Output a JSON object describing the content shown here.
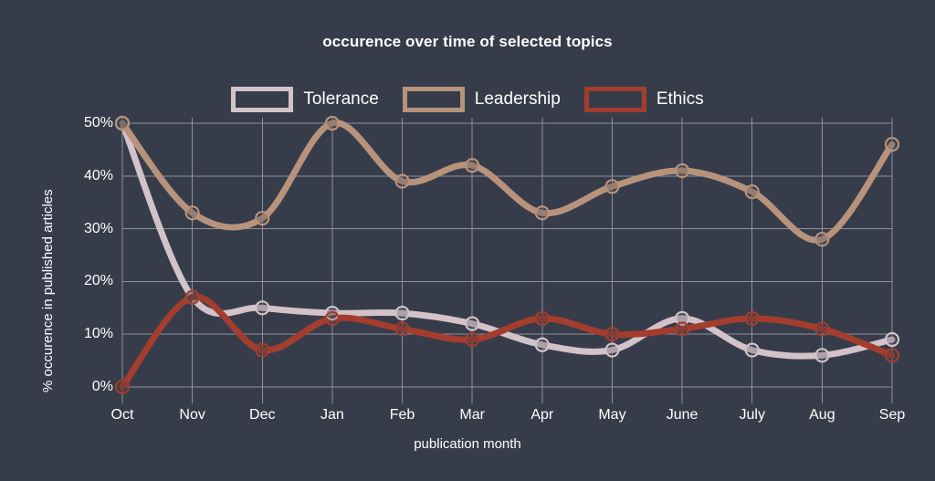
{
  "chart_data": {
    "type": "line",
    "title": "occurence over time of selected topics",
    "xlabel": "publication month",
    "ylabel": "% occurence in published articles",
    "categories": [
      "Oct",
      "Nov",
      "Dec",
      "Jan",
      "Feb",
      "Mar",
      "Apr",
      "May",
      "June",
      "July",
      "Aug",
      "Sep"
    ],
    "ylim": [
      0,
      50
    ],
    "yticks": [
      "0%",
      "10%",
      "20%",
      "30%",
      "40%",
      "50%"
    ],
    "ytick_values": [
      0,
      10,
      20,
      30,
      40,
      50
    ],
    "grid": true,
    "legend_position": "top-center",
    "smoothing": "spline",
    "markers": "open-circle",
    "series": [
      {
        "name": "Tolerance",
        "color": "#d3c3c9",
        "values": [
          50,
          17,
          15,
          14,
          14,
          12,
          8,
          7,
          13,
          7,
          6,
          9
        ]
      },
      {
        "name": "Leadership",
        "color": "#b8937c",
        "values": [
          50,
          33,
          32,
          50,
          39,
          42,
          33,
          38,
          41,
          37,
          28,
          46
        ]
      },
      {
        "name": "Ethics",
        "color": "#a33d2d",
        "values": [
          0,
          17,
          7,
          13,
          11,
          9,
          13,
          10,
          11,
          13,
          11,
          6
        ]
      }
    ]
  },
  "colors": {
    "background": "#373c4a",
    "grid": "#8d91a0",
    "text": "#ffffff"
  }
}
